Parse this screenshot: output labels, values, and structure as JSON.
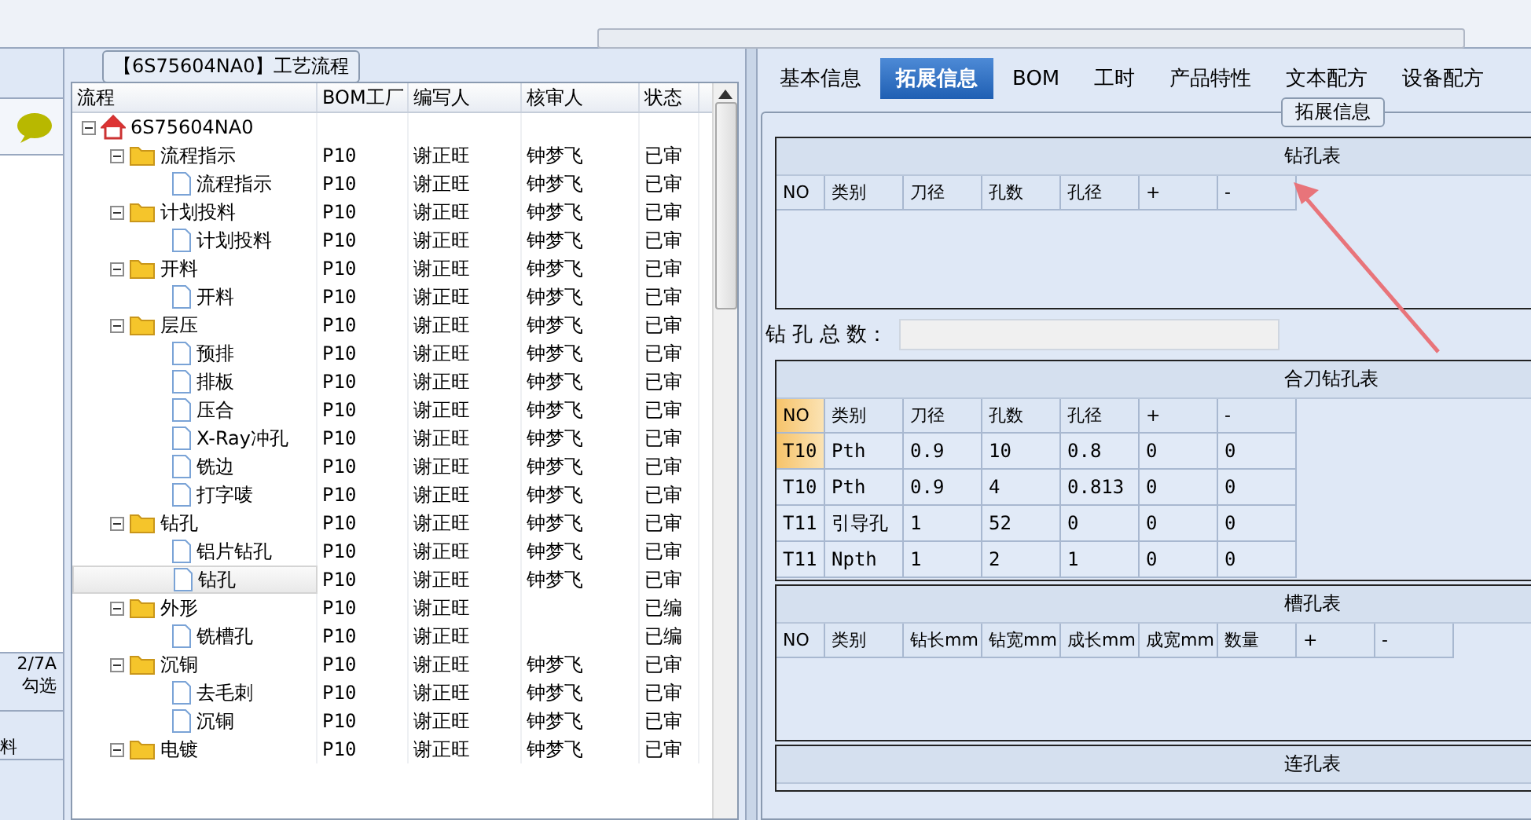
{
  "left_strip": {
    "counter": "2/7A",
    "check_label": "勾选",
    "column_1": "料"
  },
  "process_panel": {
    "title": "【6S75604NA0】工艺流程",
    "columns": [
      "流程",
      "BOM工厂",
      "编写人",
      "核审人",
      "状态"
    ],
    "tree": [
      {
        "label": "6S75604NA0",
        "kind": "root",
        "expanded": true,
        "selected": false,
        "children": [
          {
            "label": "流程指示",
            "kind": "folder",
            "expanded": true,
            "selected": false,
            "bom": "P10",
            "writer": "谢正旺",
            "reviewer": "钟梦飞",
            "status": "已审",
            "children": [
              {
                "label": "流程指示",
                "kind": "file",
                "selected": false,
                "bom": "P10",
                "writer": "谢正旺",
                "reviewer": "钟梦飞",
                "status": "已审"
              }
            ]
          },
          {
            "label": "计划投料",
            "kind": "folder",
            "expanded": true,
            "selected": false,
            "bom": "P10",
            "writer": "谢正旺",
            "reviewer": "钟梦飞",
            "status": "已审",
            "children": [
              {
                "label": "计划投料",
                "kind": "file",
                "selected": false,
                "bom": "P10",
                "writer": "谢正旺",
                "reviewer": "钟梦飞",
                "status": "已审"
              }
            ]
          },
          {
            "label": "开料",
            "kind": "folder",
            "expanded": true,
            "selected": false,
            "bom": "P10",
            "writer": "谢正旺",
            "reviewer": "钟梦飞",
            "status": "已审",
            "children": [
              {
                "label": "开料",
                "kind": "file",
                "selected": false,
                "bom": "P10",
                "writer": "谢正旺",
                "reviewer": "钟梦飞",
                "status": "已审"
              }
            ]
          },
          {
            "label": "层压",
            "kind": "folder",
            "expanded": true,
            "selected": false,
            "bom": "P10",
            "writer": "谢正旺",
            "reviewer": "钟梦飞",
            "status": "已审",
            "children": [
              {
                "label": "预排",
                "kind": "file",
                "selected": false,
                "bom": "P10",
                "writer": "谢正旺",
                "reviewer": "钟梦飞",
                "status": "已审"
              },
              {
                "label": "排板",
                "kind": "file",
                "selected": false,
                "bom": "P10",
                "writer": "谢正旺",
                "reviewer": "钟梦飞",
                "status": "已审"
              },
              {
                "label": "压合",
                "kind": "file",
                "selected": false,
                "bom": "P10",
                "writer": "谢正旺",
                "reviewer": "钟梦飞",
                "status": "已审"
              },
              {
                "label": "X-Ray冲孔",
                "kind": "file",
                "selected": false,
                "bom": "P10",
                "writer": "谢正旺",
                "reviewer": "钟梦飞",
                "status": "已审"
              },
              {
                "label": "铣边",
                "kind": "file",
                "selected": false,
                "bom": "P10",
                "writer": "谢正旺",
                "reviewer": "钟梦飞",
                "status": "已审"
              },
              {
                "label": "打字唛",
                "kind": "file",
                "selected": false,
                "bom": "P10",
                "writer": "谢正旺",
                "reviewer": "钟梦飞",
                "status": "已审"
              }
            ]
          },
          {
            "label": "钻孔",
            "kind": "folder",
            "expanded": true,
            "selected": false,
            "bom": "P10",
            "writer": "谢正旺",
            "reviewer": "钟梦飞",
            "status": "已审",
            "children": [
              {
                "label": "铝片钻孔",
                "kind": "file",
                "selected": false,
                "bom": "P10",
                "writer": "谢正旺",
                "reviewer": "钟梦飞",
                "status": "已审"
              },
              {
                "label": "钻孔",
                "kind": "file",
                "selected": true,
                "bom": "P10",
                "writer": "谢正旺",
                "reviewer": "钟梦飞",
                "status": "已审"
              }
            ]
          },
          {
            "label": "外形",
            "kind": "folder",
            "expanded": true,
            "selected": false,
            "bom": "P10",
            "writer": "谢正旺",
            "status": "已编",
            "children": [
              {
                "label": "铣槽孔",
                "kind": "file",
                "selected": false,
                "bom": "P10",
                "writer": "谢正旺",
                "status": "已编"
              }
            ]
          },
          {
            "label": "沉铜",
            "kind": "folder",
            "expanded": true,
            "selected": false,
            "bom": "P10",
            "writer": "谢正旺",
            "reviewer": "钟梦飞",
            "status": "已审",
            "children": [
              {
                "label": "去毛刺",
                "kind": "file",
                "selected": false,
                "bom": "P10",
                "writer": "谢正旺",
                "reviewer": "钟梦飞",
                "status": "已审"
              },
              {
                "label": "沉铜",
                "kind": "file",
                "selected": false,
                "bom": "P10",
                "writer": "谢正旺",
                "reviewer": "钟梦飞",
                "status": "已审"
              }
            ]
          },
          {
            "label": "电镀",
            "kind": "folder",
            "expanded": true,
            "selected": false,
            "bom": "P10",
            "writer": "谢正旺",
            "reviewer": "钟梦飞",
            "status": "已审"
          }
        ]
      }
    ]
  },
  "detail_panel": {
    "tabs": [
      {
        "label": "基本信息",
        "selected": false
      },
      {
        "label": "拓展信息",
        "selected": true
      },
      {
        "label": "BOM",
        "selected": false
      },
      {
        "label": "工时",
        "selected": false
      },
      {
        "label": "产品特性",
        "selected": false
      },
      {
        "label": "文本配方",
        "selected": false
      },
      {
        "label": "设备配方",
        "selected": false
      }
    ],
    "group_title": "拓展信息",
    "sections": [
      {
        "kind": "table",
        "title": "钻孔表",
        "columns": [
          "NO",
          "类别",
          "刀径",
          "孔数",
          "孔径",
          "+",
          "-"
        ]
      },
      {
        "kind": "field",
        "label": "钻 孔 总 数："
      },
      {
        "kind": "table",
        "title": "合刀钻孔表",
        "columns": [
          "NO",
          "类别",
          "刀径",
          "孔数",
          "孔径",
          "+",
          "-"
        ],
        "rows": [
          {
            "selected": true,
            "cells": [
              "T10",
              "Pth",
              "0.9",
              "10",
              "0.8",
              "0",
              "0"
            ]
          },
          {
            "selected": false,
            "cells": [
              "T10",
              "Pth",
              "0.9",
              "4",
              "0.813",
              "0",
              "0"
            ]
          },
          {
            "selected": false,
            "cells": [
              "T11",
              "引导孔",
              "1",
              "52",
              "0",
              "0",
              "0"
            ]
          },
          {
            "selected": false,
            "cells": [
              "T11",
              "Npth",
              "1",
              "2",
              "1",
              "0",
              "0"
            ]
          }
        ]
      },
      {
        "kind": "table",
        "title": "槽孔表",
        "columns": [
          "NO",
          "类别",
          "钻长mm",
          "钻宽mm",
          "成长mm",
          "成宽mm",
          "数量",
          "+",
          "-"
        ]
      },
      {
        "kind": "table",
        "title": "连孔表"
      }
    ]
  }
}
